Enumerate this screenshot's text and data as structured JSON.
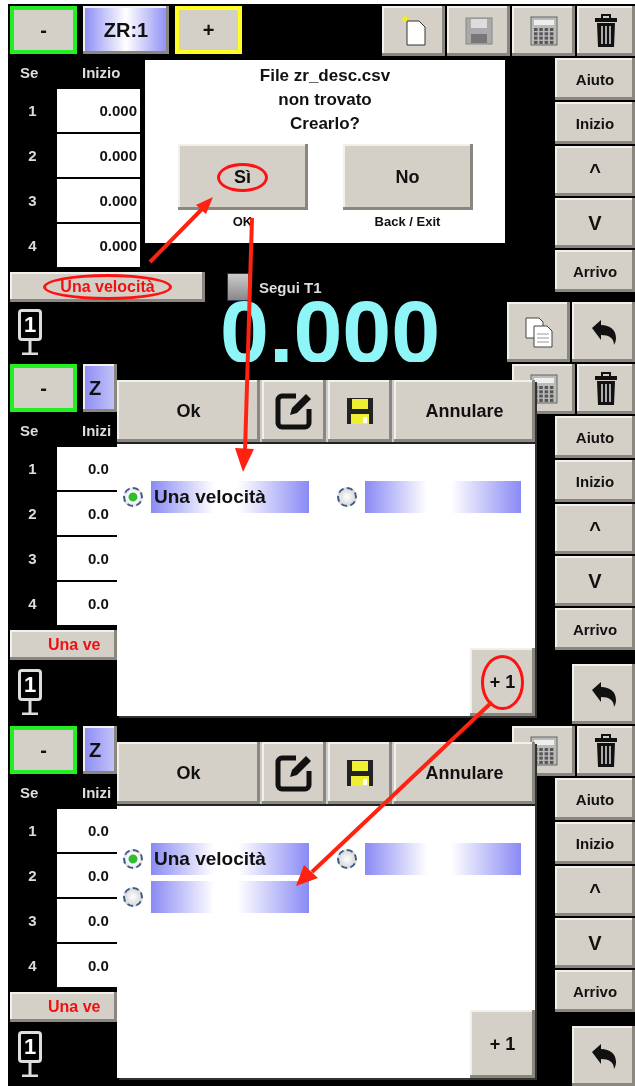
{
  "panels": [
    {
      "top_left": [
        {
          "kind": "minus",
          "label": "-"
        },
        {
          "kind": "zone",
          "label": "ZR:1"
        },
        {
          "kind": "plus",
          "label": "+"
        }
      ],
      "header": {
        "col_1": "Se",
        "col_2": "Inizio"
      },
      "rows": [
        {
          "index": "1",
          "value": "0.000"
        },
        {
          "index": "2",
          "value": "0.000"
        },
        {
          "index": "3",
          "value": "0.000"
        },
        {
          "index": "4",
          "value": "0.000"
        }
      ],
      "speed_button": {
        "label": "Una velocità",
        "circled": true
      },
      "follow": {
        "label": "Segui T1",
        "checked": false
      },
      "station": "1",
      "big_value": "0.000",
      "right_buttons": [
        "Aiuto",
        "Inizio",
        "^",
        "V",
        "Arrivo"
      ],
      "dialog": {
        "kind": "confirm",
        "lines": [
          "File zr_desc.csv",
          "non trovato",
          "Crearlo?"
        ],
        "buttons": [
          {
            "label": "Sì",
            "caption": "OK",
            "circled": true
          },
          {
            "label": "No",
            "caption": "Back / Exit",
            "circled": false
          }
        ]
      }
    },
    {
      "top_left": [
        {
          "kind": "minus",
          "label": "-"
        },
        {
          "kind": "zone",
          "label": "Z"
        }
      ],
      "header": {
        "col_1": "Se",
        "col_2": "Inizi"
      },
      "rows": [
        {
          "index": "1",
          "value": "0.0"
        },
        {
          "index": "2",
          "value": "0.0"
        },
        {
          "index": "3",
          "value": "0.0"
        },
        {
          "index": "4",
          "value": "0.0"
        }
      ],
      "speed_button": {
        "label": "Una ve",
        "circled": false
      },
      "station": "1",
      "right_buttons": [
        "Aiuto",
        "Inizio",
        "^",
        "V",
        "Arrivo"
      ],
      "dialog": {
        "kind": "list",
        "buttons": [
          {
            "kind": "text",
            "label": "Ok"
          },
          {
            "kind": "edit"
          },
          {
            "kind": "save"
          },
          {
            "kind": "text",
            "label": "Annulare"
          }
        ],
        "options": [
          {
            "label": "Una velocità",
            "selected": true
          },
          {
            "selected": false
          }
        ],
        "add_button": {
          "label": "+ 1",
          "circled": true
        }
      }
    },
    {
      "top_left": [
        {
          "kind": "minus",
          "label": "-"
        },
        {
          "kind": "zone",
          "label": "Z"
        }
      ],
      "header": {
        "col_1": "Se",
        "col_2": "Inizi"
      },
      "rows": [
        {
          "index": "1",
          "value": "0.0"
        },
        {
          "index": "2",
          "value": "0.0"
        },
        {
          "index": "3",
          "value": "0.0"
        },
        {
          "index": "4",
          "value": "0.0"
        }
      ],
      "speed_button": {
        "label": "Una ve",
        "circled": false
      },
      "station": "1",
      "right_buttons": [
        "Aiuto",
        "Inizio",
        "^",
        "V",
        "Arrivo"
      ],
      "dialog": {
        "kind": "list",
        "buttons": [
          {
            "kind": "text",
            "label": "Ok"
          },
          {
            "kind": "edit"
          },
          {
            "kind": "save"
          },
          {
            "kind": "text",
            "label": "Annulare"
          }
        ],
        "options": [
          {
            "label": "Una velocità",
            "selected": true
          },
          {
            "selected": false
          },
          {
            "selected": false
          }
        ],
        "add_button": {
          "label": "+ 1",
          "circled": false
        }
      }
    }
  ]
}
